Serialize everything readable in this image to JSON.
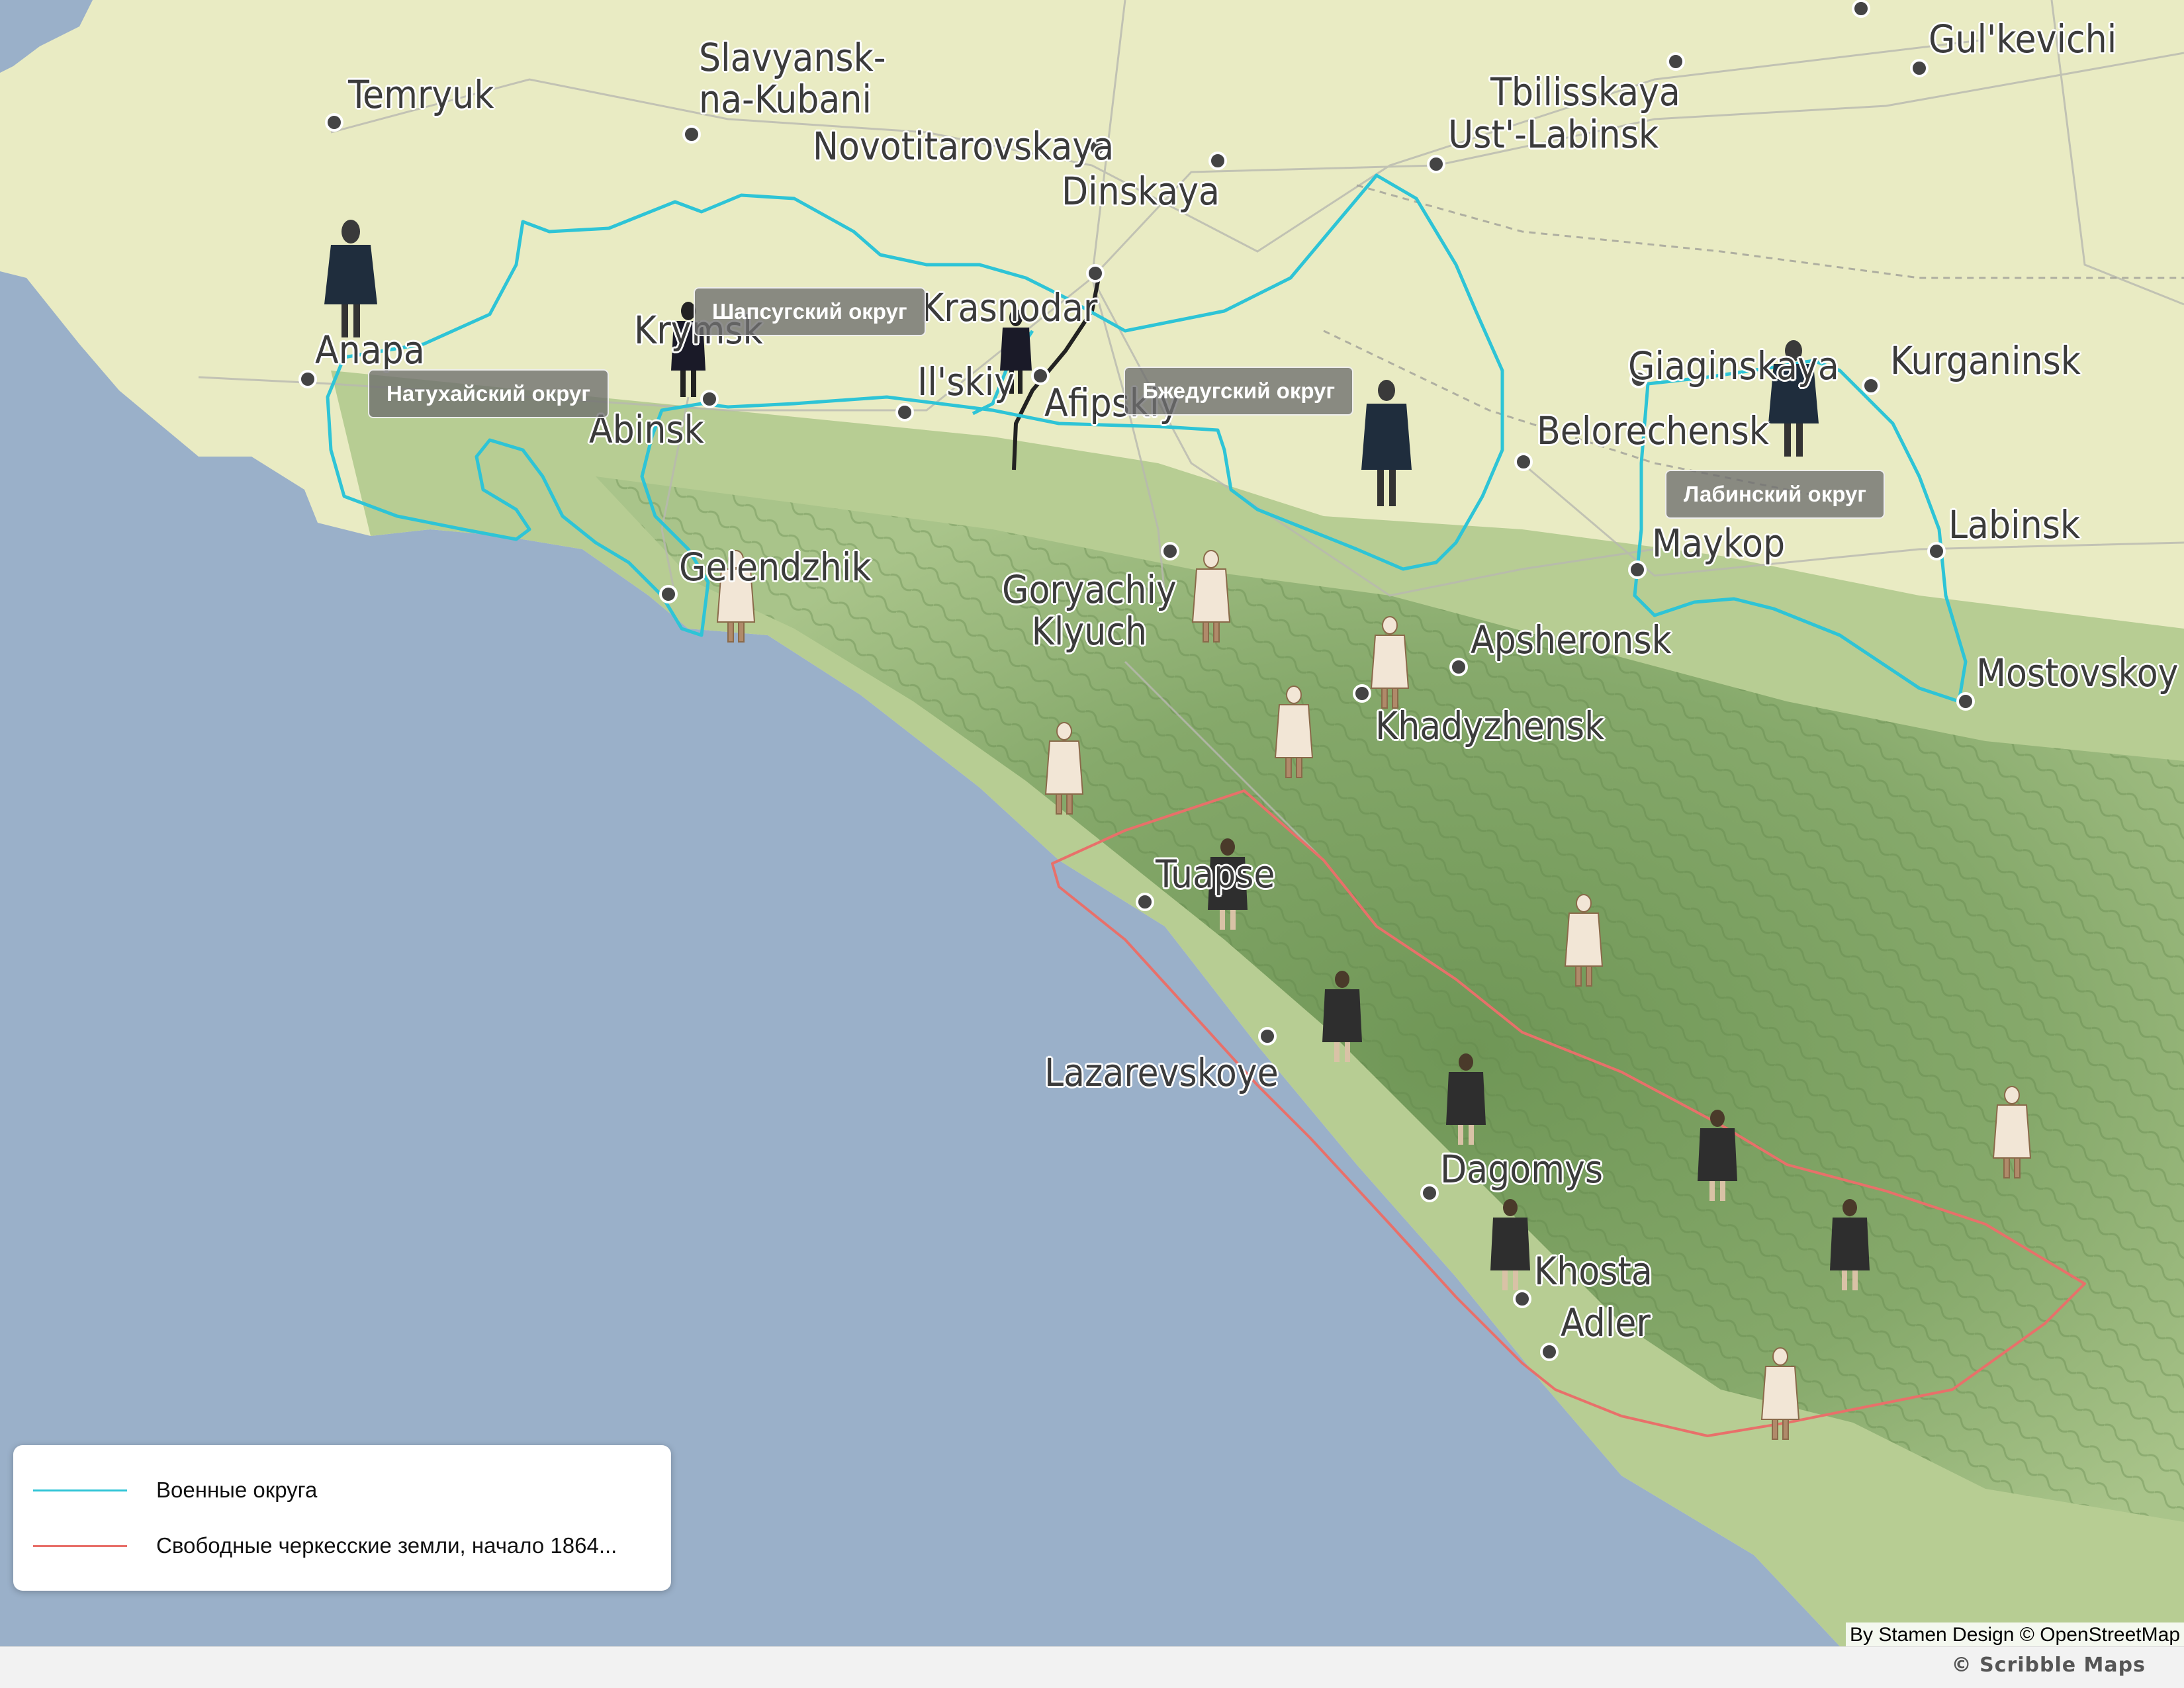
{
  "map": {
    "cities": [
      {
        "id": "temryuk",
        "name": "Temryuk"
      },
      {
        "id": "slavyansk",
        "name": "Slavyansk-\nna-Kubani"
      },
      {
        "id": "novotitarovskaya",
        "name": "Novotitarovskaya"
      },
      {
        "id": "dinskaya",
        "name": "Dinskaya"
      },
      {
        "id": "tbilisskaya",
        "name": "Tbilisskaya"
      },
      {
        "id": "ustlabinsk",
        "name": "Ust'-Labinsk"
      },
      {
        "id": "gulkevichi",
        "name": "Gul'kevichi"
      },
      {
        "id": "anapa",
        "name": "Anapa"
      },
      {
        "id": "krymsk",
        "name": "Krymsk"
      },
      {
        "id": "krasnodar",
        "name": "Krasnodar"
      },
      {
        "id": "ilskiy",
        "name": "Il'skiy"
      },
      {
        "id": "afipskiy",
        "name": "Afipskiy"
      },
      {
        "id": "abinsk",
        "name": "Abinsk"
      },
      {
        "id": "giaginskaya",
        "name": "Giaginskaya"
      },
      {
        "id": "kurganinsk",
        "name": "Kurganinsk"
      },
      {
        "id": "belorechensk",
        "name": "Belorechensk"
      },
      {
        "id": "maykop",
        "name": "Maykop"
      },
      {
        "id": "labinsk",
        "name": "Labinsk"
      },
      {
        "id": "mostovskoy",
        "name": "Mostovskoy"
      },
      {
        "id": "gelendzhik",
        "name": "Gelendzhik"
      },
      {
        "id": "goryachiy",
        "name": "Goryachiy\nKlyuch"
      },
      {
        "id": "apsheronsk",
        "name": "Apsheronsk"
      },
      {
        "id": "khadyzhensk",
        "name": "Khadyzhensk"
      },
      {
        "id": "tuapse",
        "name": "Tuapse"
      },
      {
        "id": "lazarevskoye",
        "name": "Lazarevskoye"
      },
      {
        "id": "dagomys",
        "name": "Dagomys"
      },
      {
        "id": "khosta",
        "name": "Khosta"
      },
      {
        "id": "adler",
        "name": "Adler"
      }
    ],
    "district_labels": [
      {
        "id": "natukhay",
        "text": "Натухайский округ"
      },
      {
        "id": "shapsug",
        "text": "Шапсугский округ"
      },
      {
        "id": "bzhedug",
        "text": "Бжедугский округ"
      },
      {
        "id": "labinsk",
        "text": "Лабинский округ"
      }
    ],
    "colors": {
      "sea": "#9ab0c9",
      "lowland": "#e9ebc3",
      "hills": "#a9c48a",
      "mountains": "#7fa264",
      "military_districts_line": "#2ec4d6",
      "free_lands_line": "#e8706a"
    }
  },
  "legend": {
    "items": [
      {
        "label": "Военные округа",
        "color": "#2ec4d6"
      },
      {
        "label": "Свободные черкесские земли, начало 1864...",
        "color": "#e8706a"
      }
    ]
  },
  "attribution": "By Stamen Design © OpenStreetMap",
  "footer": {
    "brand": "© Scribble Maps"
  }
}
